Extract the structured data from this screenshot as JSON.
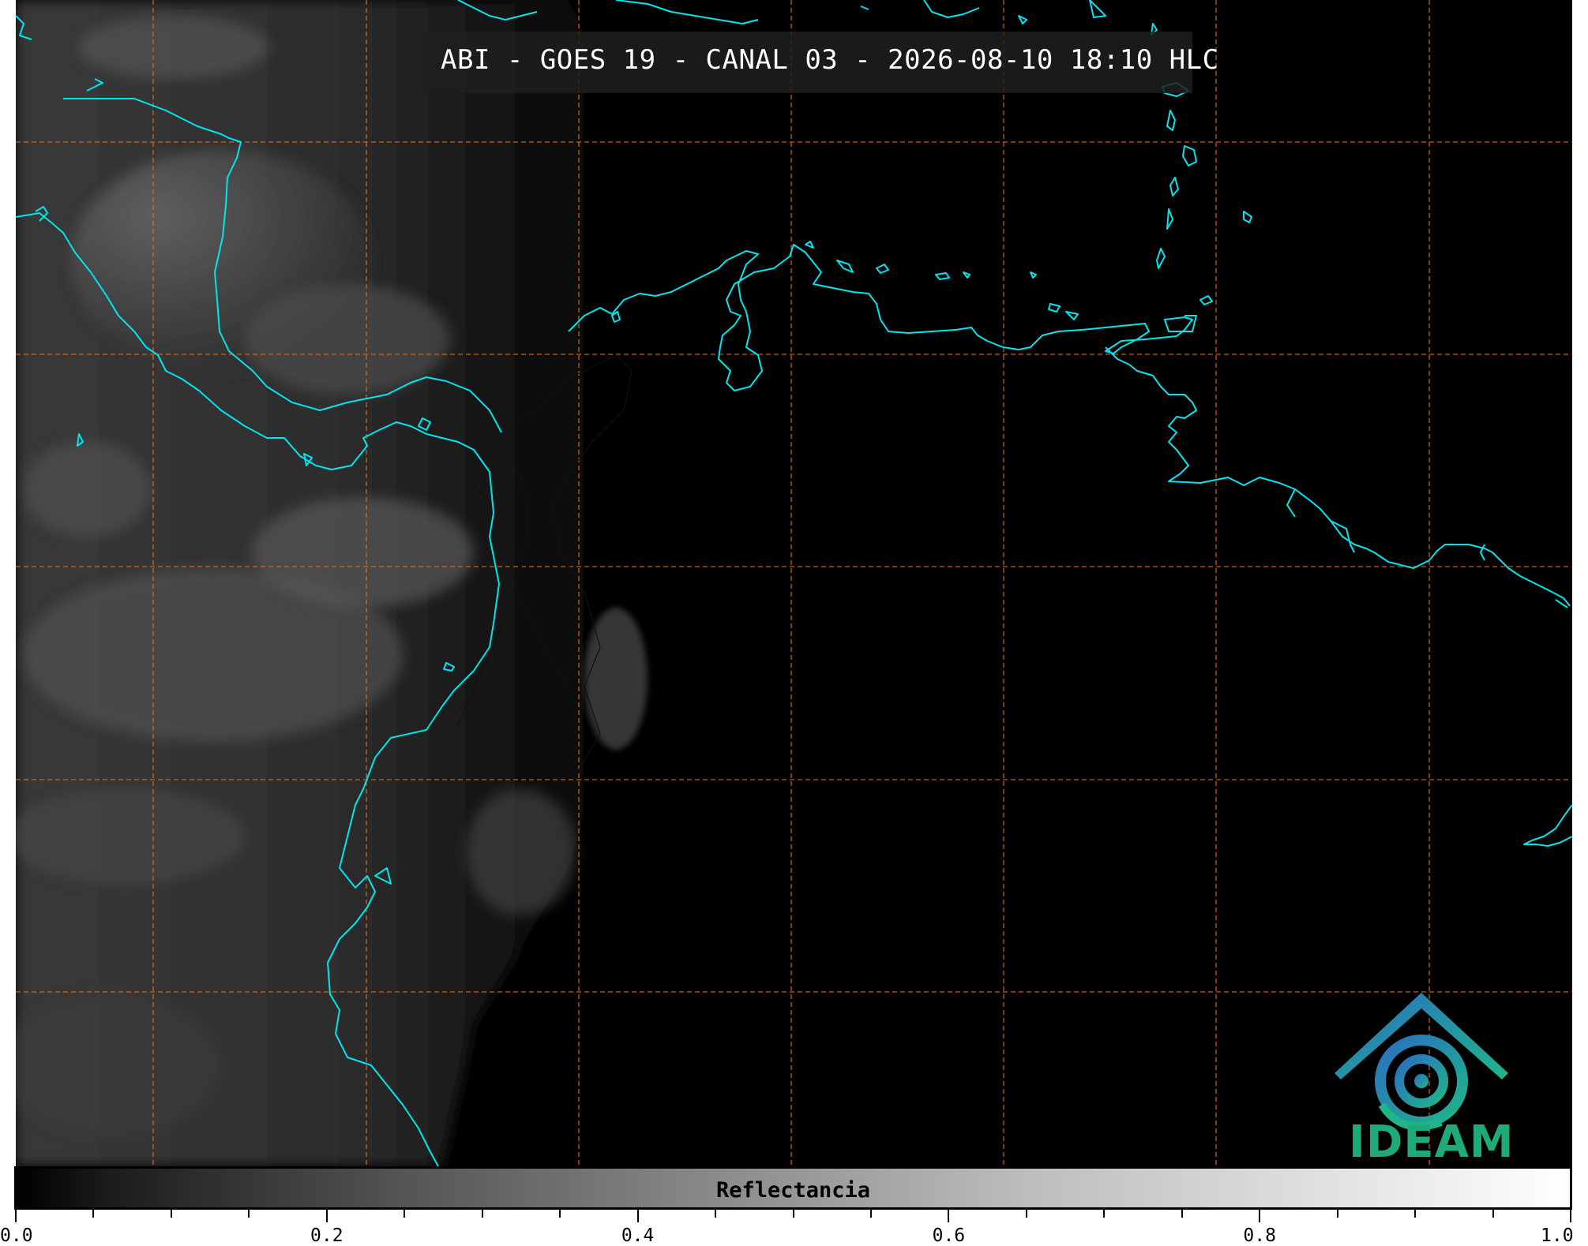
{
  "title": "ABI - GOES 19 - CANAL 03 - 2026-08-10 18:10 HLC",
  "logo": {
    "text": "IDEAM",
    "colors": [
      "#2a7fb8",
      "#1fb58a"
    ]
  },
  "colorbar": {
    "label": "Reflectancia",
    "ticks": [
      "0.0",
      "0.2",
      "0.4",
      "0.6",
      "0.8",
      "1.0"
    ],
    "range": [
      0.0,
      1.0
    ],
    "colormap": "grayscale"
  },
  "map": {
    "coastline_color": "#00e5ee",
    "grid_color": "#e07020",
    "grid_style": "dashed",
    "background": "#000000"
  }
}
